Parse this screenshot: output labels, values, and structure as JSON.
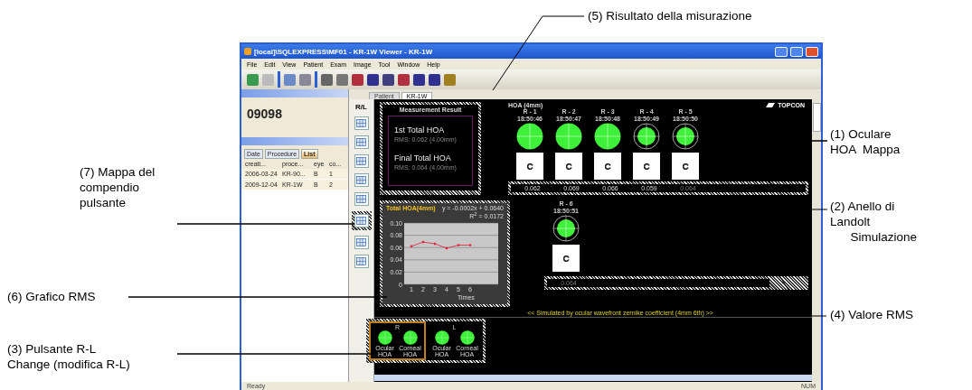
{
  "window": {
    "title": "[local]\\SQLEXPRESS\\MF01 - KR-1W Viewer - KR-1W"
  },
  "menu": [
    "File",
    "Edit",
    "View",
    "Patient",
    "Exam",
    "Image",
    "Tool",
    "Window",
    "Help"
  ],
  "patient_id": "09098",
  "exam_list": {
    "tabs": [
      {
        "label": "Date",
        "selected": false
      },
      {
        "label": "Procedure",
        "selected": false
      },
      {
        "label": "List",
        "selected": true
      }
    ],
    "columns": [
      "creati...",
      "proce...",
      "eye",
      "co..."
    ],
    "rows": [
      [
        "2006-03-24",
        "KR-90...",
        "B",
        "1"
      ],
      [
        "2009-12-04",
        "KR-1W",
        "B",
        "2"
      ]
    ]
  },
  "doc_tabs": [
    {
      "label": "Patient",
      "selected": false
    },
    {
      "label": "KR-1W",
      "selected": true
    }
  ],
  "side_toolbar": {
    "rl_label": "R/L",
    "highlighted": [
      false,
      false,
      false,
      false,
      false,
      true,
      false,
      false
    ]
  },
  "measurement": {
    "title": "Measurement Result",
    "first_label": "1st Total HOA",
    "first_rms": "RMS: 0.062 (4.00mm)",
    "final_label": "Final Total HOA",
    "final_rms": "RMS: 0.064 (4.00mm)"
  },
  "hoa": {
    "title": "HOA (4mm)",
    "logo": "TOPCON",
    "maps": [
      {
        "label": "R - 1",
        "time": "18:50:46",
        "ring": false,
        "rms": "0.062",
        "dimmed": false
      },
      {
        "label": "R - 2",
        "time": "18:50:47",
        "ring": false,
        "rms": "0.069",
        "dimmed": false
      },
      {
        "label": "R - 3",
        "time": "18:50:48",
        "ring": false,
        "rms": "0.066",
        "dimmed": false
      },
      {
        "label": "R - 4",
        "time": "18:50:49",
        "ring": true,
        "rms": "0.059",
        "dimmed": false
      },
      {
        "label": "R - 5",
        "time": "18:50:50",
        "ring": true,
        "rms": "0.064",
        "dimmed": true
      },
      {
        "label": "R - 6",
        "time": "18:50:51",
        "ring": true,
        "rms": "0.064",
        "dimmed": true
      }
    ]
  },
  "chart": {
    "equation": "y = -0.0002x + 0.0640",
    "r_squared": "R$^{2}$ = 0.0172",
    "chart_data": {
      "type": "line",
      "title": "Total HOA(4mm)",
      "xlabel": "Times",
      "categories": [
        "1",
        "2",
        "3",
        "4",
        "5",
        "6"
      ],
      "series": [
        {
          "color": "#e0203a",
          "values": [
            0.062,
            0.069,
            0.066,
            0.059,
            0.064,
            0.064
          ]
        }
      ],
      "grid": true,
      "ylim": [
        0,
        0.1
      ],
      "yticks": [
        0,
        {
          "value": 0.02,
          "label": "0.02"
        },
        {
          "value": 0.04,
          "label": "0.04"
        },
        {
          "value": 0.06,
          "label": "0.06"
        },
        {
          "value": 0.08,
          "label": "0.08"
        },
        {
          "value": 0.1,
          "label": "0.10"
        }
      ]
    }
  },
  "footer_note": "<< Simulated by ocular wavefront zernike coefficient (4mm 6th) >>",
  "rl_change": [
    {
      "eye": "R",
      "selected": true,
      "maps": [
        "Ocular HOA",
        "Corneal HOA"
      ]
    },
    {
      "eye": "L",
      "selected": false,
      "maps": [
        "Ocular HOA",
        "Corneal HOA"
      ]
    }
  ],
  "status_bar": {
    "text": "Ready",
    "indicators": [
      "NUM"
    ]
  },
  "callouts": [
    {
      "text": "(5) Risultato della misurazione"
    },
    {
      "text": "(1) Oculare\nHOA  Mappa"
    },
    {
      "text": "(2) Anello di\nLandolt\n      Simulazione"
    },
    {
      "text": "(4) Valore RMS"
    },
    {
      "text": "(7) Mappa del\ncompendio\npulsante"
    },
    {
      "text": "(6) Grafico RMS"
    },
    {
      "text": "(3) Pulsante R-L\nChange (modifica R-L)"
    }
  ]
}
